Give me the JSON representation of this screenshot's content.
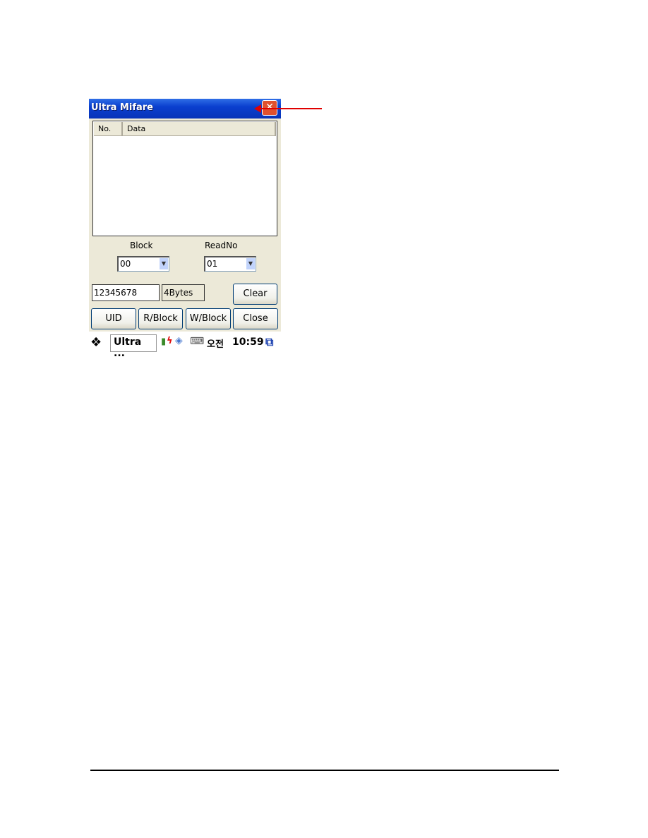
{
  "window": {
    "title": "Ultra Mifare",
    "close_glyph": "✕"
  },
  "list": {
    "columns": [
      "No.",
      "Data"
    ],
    "rows": []
  },
  "block": {
    "label": "Block",
    "value": "00"
  },
  "readno": {
    "label": "ReadNo",
    "value": "01"
  },
  "data_field": {
    "value": "12345678"
  },
  "size_field": {
    "value": "4Bytes"
  },
  "buttons": {
    "clear": "Clear",
    "uid": "UID",
    "rblock": "R/Block",
    "wblock": "W/Block",
    "close": "Close"
  },
  "taskbar": {
    "task_label": "Ultra ...",
    "ampm": "오전",
    "time": "10:59"
  },
  "annotation": {
    "arrow_color": "#e00000"
  }
}
